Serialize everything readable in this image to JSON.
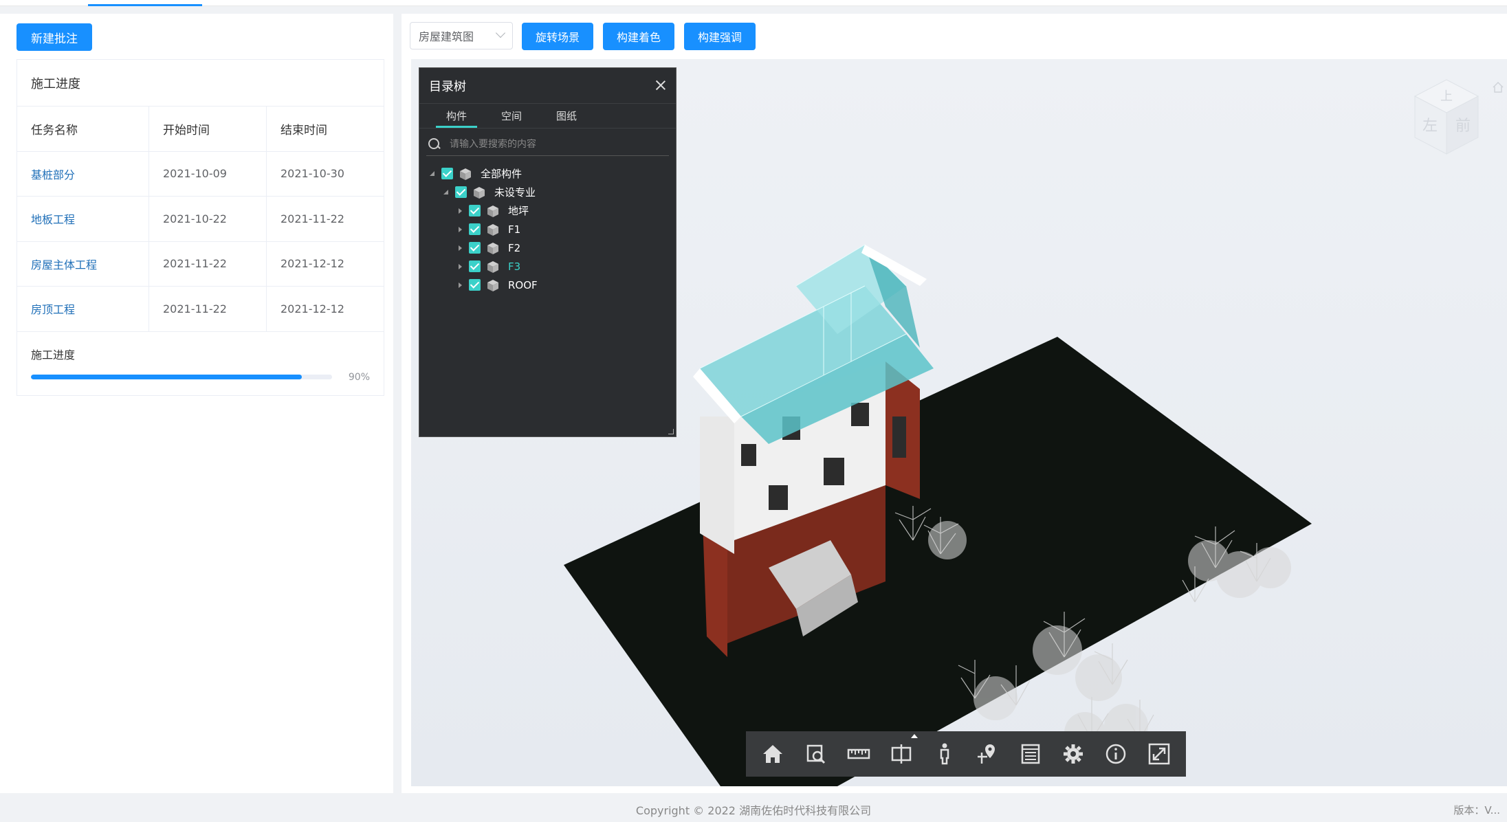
{
  "left": {
    "new_button": "新建批注",
    "card_title": "施工进度",
    "table": {
      "headers": [
        "任务名称",
        "开始时间",
        "结束时间"
      ],
      "rows": [
        {
          "name": "基桩部分",
          "start": "2021-10-09",
          "end": "2021-10-30"
        },
        {
          "name": "地板工程",
          "start": "2021-10-22",
          "end": "2021-11-22"
        },
        {
          "name": "房屋主体工程",
          "start": "2021-11-22",
          "end": "2021-12-12"
        },
        {
          "name": "房顶工程",
          "start": "2021-11-22",
          "end": "2021-12-12"
        }
      ]
    },
    "progress": {
      "label": "施工进度",
      "percent_text": "90%",
      "value": 0.9
    }
  },
  "right": {
    "select_value": "房屋建筑图",
    "buttons": [
      "旋转场景",
      "构建着色",
      "构建强调"
    ]
  },
  "tree": {
    "title": "目录树",
    "tabs": [
      "构件",
      "空间",
      "图纸"
    ],
    "search_placeholder": "请输入要搜索的内容",
    "nodes": [
      {
        "label": "全部构件",
        "level": 0,
        "expanded": true
      },
      {
        "label": "未设专业",
        "level": 1,
        "expanded": true
      },
      {
        "label": "地坪",
        "level": 2,
        "expanded": false
      },
      {
        "label": "F1",
        "level": 2,
        "expanded": false
      },
      {
        "label": "F2",
        "level": 2,
        "expanded": false
      },
      {
        "label": "F3",
        "level": 2,
        "expanded": false,
        "highlighted": true
      },
      {
        "label": "ROOF",
        "level": 2,
        "expanded": false
      }
    ]
  },
  "viewcube": {
    "labels": [
      "上",
      "左",
      "前"
    ]
  },
  "toolbar": {
    "icons": [
      "home-icon",
      "zoom-window-icon",
      "measure-ruler-icon",
      "section-box-icon",
      "walk-person-icon",
      "pin-location-icon",
      "properties-list-icon",
      "settings-gear-icon",
      "info-icon",
      "fullscreen-icon"
    ]
  },
  "footer": {
    "copyright": "Copyright © 2022 湖南佐佑时代科技有限公司",
    "version": "版本：V..."
  },
  "colors": {
    "primary": "#1890ff",
    "accent": "#3bd1c9",
    "panel": "#2b2d30",
    "toolbar": "#393b3d"
  }
}
